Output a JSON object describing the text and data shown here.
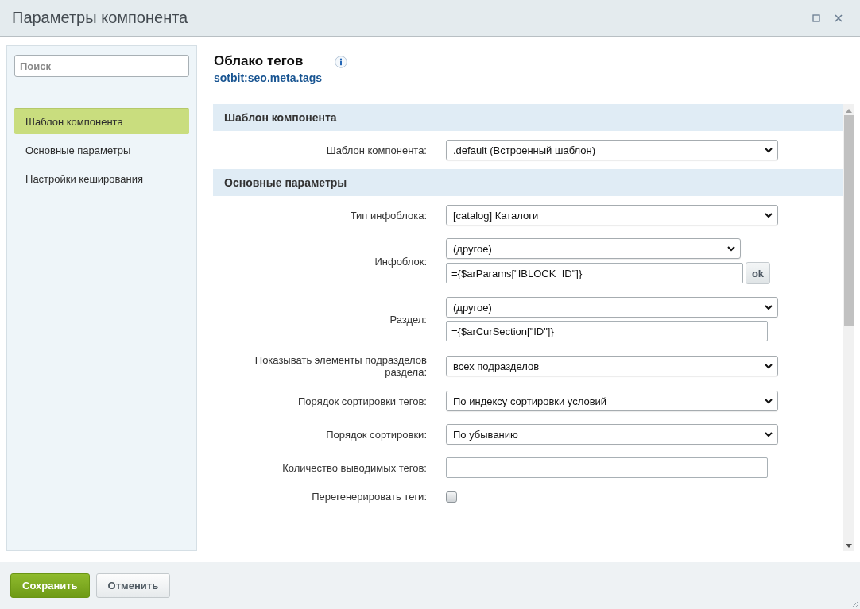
{
  "window": {
    "title": "Параметры компонента"
  },
  "sidebar": {
    "search": {
      "placeholder": "Поиск"
    },
    "items": [
      {
        "label": "Шаблон компонента",
        "selected": true
      },
      {
        "label": "Основные параметры",
        "selected": false
      },
      {
        "label": "Настройки кеширования",
        "selected": false
      }
    ]
  },
  "component": {
    "name": "Облако тегов",
    "code": "sotbit:seo.meta.tags"
  },
  "sections": [
    {
      "title": "Шаблон компонента",
      "rows": [
        {
          "kind": "select",
          "label": "Шаблон компонента:",
          "value": ".default (Встроенный шаблон)"
        }
      ]
    },
    {
      "title": "Основные параметры",
      "rows": [
        {
          "kind": "select",
          "label": "Тип инфоблока:",
          "value": "[catalog] Каталоги"
        },
        {
          "kind": "select_other",
          "label": "Инфоблок:",
          "value": "(другое)",
          "input": "={$arParams[\"IBLOCK_ID\"]}",
          "button": "ok"
        },
        {
          "kind": "select_other",
          "label": "Раздел:",
          "value": "(другое)",
          "input": "={$arCurSection[\"ID\"]}"
        },
        {
          "kind": "select",
          "label": "Показывать элементы подразделов раздела:",
          "value": "всех подразделов"
        },
        {
          "kind": "select",
          "label": "Порядок сортировки тегов:",
          "value": "По индексу сортировки условий"
        },
        {
          "kind": "select",
          "label": "Порядок сортировки:",
          "value": "По убыванию"
        },
        {
          "kind": "input",
          "label": "Количество выводимых тегов:"
        },
        {
          "kind": "checkbox",
          "label": "Перегенерировать теги:",
          "checked": false
        }
      ]
    }
  ],
  "buttons": [
    {
      "label": "Сохранить",
      "kind": "primary"
    },
    {
      "label": "Отменить",
      "kind": "secondary"
    }
  ]
}
